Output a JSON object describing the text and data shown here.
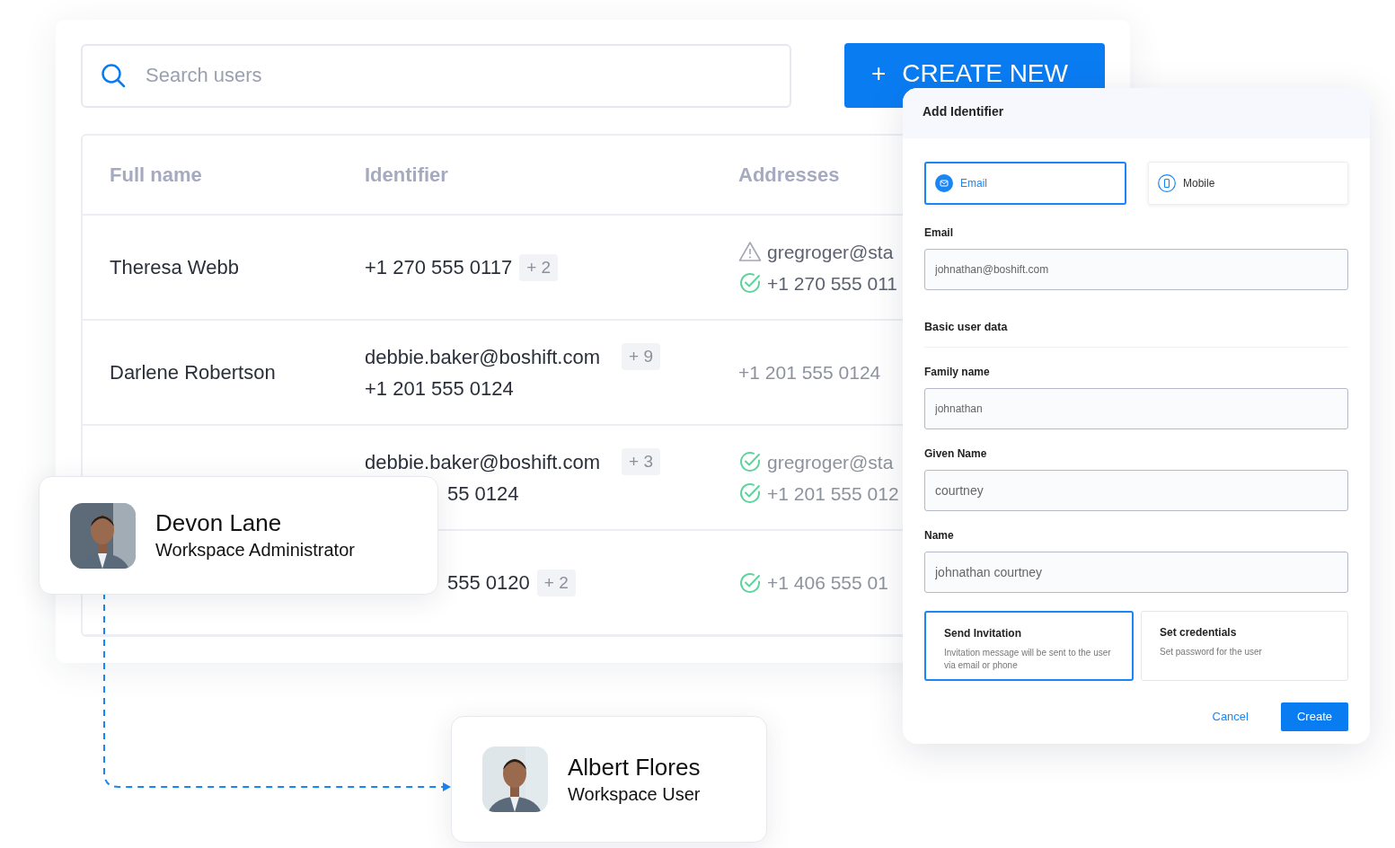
{
  "search": {
    "placeholder": "Search users"
  },
  "create_button": {
    "icon": "+",
    "label": "CREATE NEW"
  },
  "table": {
    "columns": [
      "Full name",
      "Identifier",
      "Addresses"
    ],
    "rows": [
      {
        "name": "Theresa Webb",
        "identifier": [
          {
            "text": "+1 270 555 0117",
            "extra": "+ 2"
          }
        ],
        "addresses": [
          {
            "kind": "warning",
            "text": "gregroger@sta"
          },
          {
            "kind": "verified",
            "text": "+1 270 555 011"
          }
        ]
      },
      {
        "name": "Darlene Robertson",
        "identifier": [
          {
            "text": "debbie.baker@boshift.com",
            "extra": "+ 9"
          },
          {
            "text": "+1 201 555 0124"
          }
        ],
        "addresses": [
          {
            "kind": "plain",
            "text": "+1 201 555 0124"
          }
        ]
      },
      {
        "identifier": [
          {
            "text": "debbie.baker@boshift.com",
            "extra": "+ 3"
          },
          {
            "text": "55 0124",
            "partial": true
          }
        ],
        "addresses": [
          {
            "kind": "verified",
            "text": "gregroger@sta"
          },
          {
            "kind": "verified",
            "text": "+1 201 555 012"
          }
        ]
      },
      {
        "identifier": [
          {
            "text": "555 0120",
            "extra": "+ 2",
            "partial": true
          }
        ],
        "addresses": [
          {
            "kind": "verified",
            "text": "+1 406 555 01"
          }
        ]
      }
    ]
  },
  "dialog": {
    "title": "Add Identifier",
    "identifier_types": [
      {
        "kind": "email",
        "label": "Email",
        "selected": true
      },
      {
        "kind": "mobile",
        "label": "Mobile",
        "selected": false
      }
    ],
    "identifier_field": {
      "label": "Email",
      "value": "johnathan@boshift.com"
    },
    "section": "Basic user data",
    "fields": [
      {
        "label": "Family name",
        "value": "johnathan"
      },
      {
        "label": "Given Name",
        "value": "courtney"
      },
      {
        "label": "Name",
        "value": "johnathan courtney"
      }
    ],
    "options": [
      {
        "title": "Send Invitation",
        "description": "Invitation message will be sent to the user via email or phone",
        "selected": true
      },
      {
        "title": "Set credentials",
        "description": "Set password for the user",
        "selected": false
      }
    ],
    "buttons": [
      {
        "kind": "link",
        "label": "Cancel"
      },
      {
        "kind": "primary",
        "label": "Create"
      }
    ]
  },
  "user_cards": [
    {
      "name": "Devon Lane",
      "role": "Workspace Administrator"
    },
    {
      "name": "Albert Flores",
      "role": "Workspace User"
    }
  ]
}
